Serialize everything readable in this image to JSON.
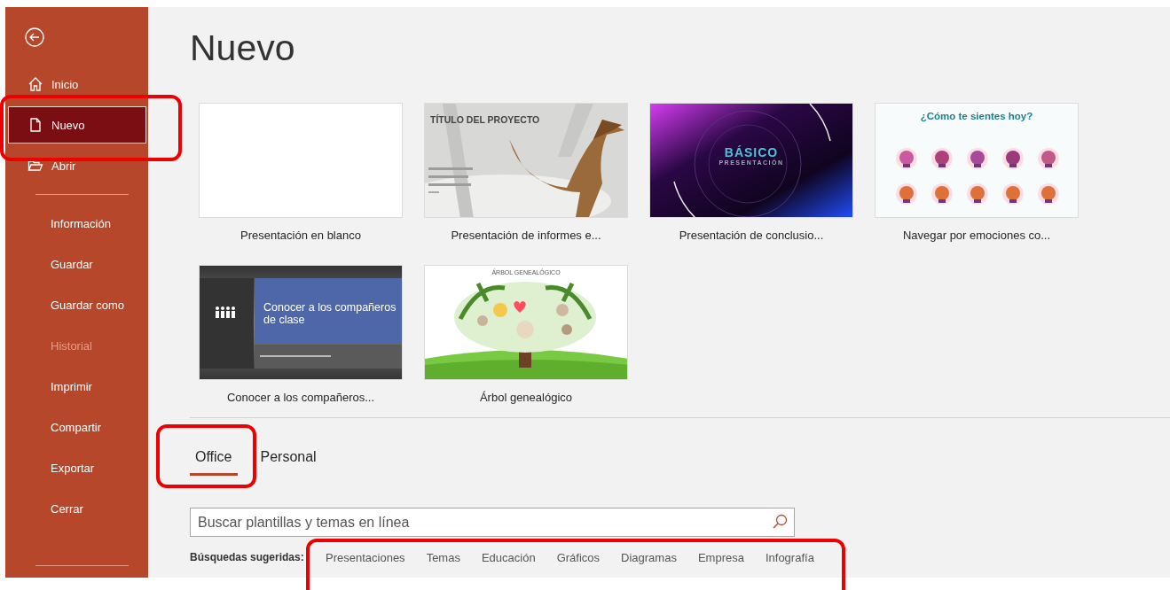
{
  "sidebar": {
    "primary_items": [
      {
        "label": "Inicio",
        "selected": false,
        "highlighted": false
      },
      {
        "label": "Nuevo",
        "selected": true,
        "highlighted": true
      },
      {
        "label": "Abrir",
        "selected": false,
        "highlighted": false
      }
    ],
    "secondary_items": [
      {
        "label": "Información",
        "disabled": false
      },
      {
        "label": "Guardar",
        "disabled": false
      },
      {
        "label": "Guardar como",
        "disabled": false
      },
      {
        "label": "Historial",
        "disabled": true
      },
      {
        "label": "Imprimir",
        "disabled": false
      },
      {
        "label": "Compartir",
        "disabled": false
      },
      {
        "label": "Exportar",
        "disabled": false
      },
      {
        "label": "Cerrar",
        "disabled": false
      }
    ]
  },
  "page_title": "Nuevo",
  "templates": [
    {
      "name": "Presentación en blanco",
      "kind": "blank"
    },
    {
      "name": "Presentación de informes e...",
      "kind": "dinosaur",
      "preview": {
        "title": "TÍTULO DEL PROYECTO"
      }
    },
    {
      "name": "Presentación de conclusio...",
      "kind": "basic",
      "preview": {
        "title": "BÁSICO",
        "subtitle": "PRESENTACIÓN"
      }
    },
    {
      "name": "Navegar por emociones co...",
      "kind": "emotions",
      "preview": {
        "title": "¿Cómo te sientes hoy?"
      }
    },
    {
      "name": "Conocer a los compañeros...",
      "kind": "classmates",
      "preview": {
        "title": "Conocer a los compañeros de clase"
      }
    },
    {
      "name": "Árbol genealógico",
      "kind": "tree",
      "preview": {
        "title": "ÁRBOL GENEALÓGICO"
      }
    }
  ],
  "tabs": [
    {
      "label": "Office",
      "selected": true,
      "highlighted": true
    },
    {
      "label": "Personal",
      "selected": false,
      "highlighted": false
    }
  ],
  "search": {
    "placeholder": "Buscar plantillas y temas en línea"
  },
  "suggestions": {
    "label": "Búsquedas sugeridas:",
    "highlighted": true,
    "items": [
      "Presentaciones",
      "Temas",
      "Educación",
      "Gráficos",
      "Diagramas",
      "Empresa",
      "Infografía"
    ]
  }
}
